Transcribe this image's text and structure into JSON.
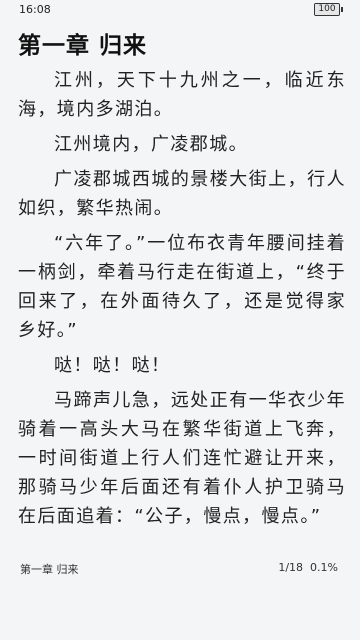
{
  "status_bar": {
    "time": "16:08",
    "battery_level": "100",
    "battery_fraction": 1.0
  },
  "chapter": {
    "title": "第一章 归来"
  },
  "paragraphs": [
    "江州，天下十九州之一，临近东海，境内多湖泊。",
    "江州境内，广凌郡城。",
    "广凌郡城西城的景楼大街上，行人如织，繁华热闹。",
    "“六年了。”一位布衣青年腰间挂着一柄剑，牵着马行走在街道上，“终于回来了，在外面待久了，还是觉得家乡好。”",
    "哒！哒！哒！",
    "马蹄声儿急，远处正有一华衣少年骑着一高头大马在繁华街道上飞奔，一时间街道上行人们连忙避让开来，那骑马少年后面还有着仆人护卫骑马在后面追着：“公子，慢点，慢点。”"
  ],
  "footer": {
    "chapter_label": "第一章 归来",
    "page": "1/18",
    "percent": "0.1%"
  }
}
